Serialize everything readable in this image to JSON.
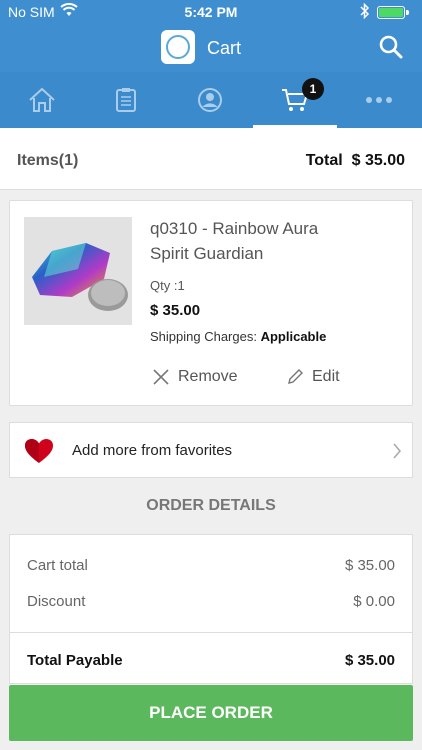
{
  "status_bar": {
    "carrier": "No SIM",
    "time": "5:42 PM"
  },
  "header": {
    "title": "Cart",
    "logo_icon": "store-logo-icon",
    "search_icon": "search-icon"
  },
  "tabs": [
    {
      "name": "home",
      "icon": "home-icon"
    },
    {
      "name": "orders",
      "icon": "clipboard-icon"
    },
    {
      "name": "account",
      "icon": "user-icon"
    },
    {
      "name": "cart",
      "icon": "cart-icon",
      "badge": "1",
      "active": true
    },
    {
      "name": "more",
      "icon": "more-icon"
    }
  ],
  "summary": {
    "items_label": "Items",
    "items_count": "(1)",
    "total_label": "Total",
    "total_value": "$ 35.00"
  },
  "cart_item": {
    "name_line1": "q0310 - Rainbow Aura",
    "name_line2": "Spirit Guardian",
    "qty": "Qty :1",
    "price": "$ 35.00",
    "shipping_label": "Shipping Charges:",
    "shipping_value": "Applicable",
    "remove_label": "Remove",
    "edit_label": "Edit"
  },
  "favorites": {
    "label": "Add more from favorites"
  },
  "order_details": {
    "title": "ORDER DETAILS",
    "rows": [
      {
        "label": "Cart total",
        "value": "$ 35.00"
      },
      {
        "label": "Discount",
        "value": "$ 0.00"
      }
    ],
    "total_label": "Total Payable",
    "total_value": "$ 35.00"
  },
  "place_order_label": "PLACE ORDER",
  "colors": {
    "header_blue": "#3f8fd0",
    "tab_blue": "#3b8acb",
    "place_order_green": "#5cb85c",
    "heart_red": "#d0021b"
  }
}
